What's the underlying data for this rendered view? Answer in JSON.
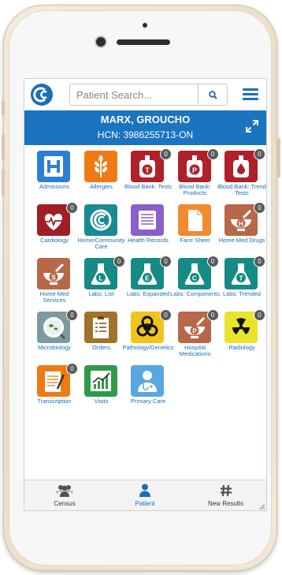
{
  "colors": {
    "brand": "#1a74c0",
    "label": "#1a6db8",
    "badge": "#5a5a5a",
    "tab_inactive": "#4f5357"
  },
  "search": {
    "placeholder": "Patient Search..."
  },
  "patient": {
    "name": "MARX, GROUCHO",
    "hcn": "HCN: 3986255713-ON"
  },
  "tiles": [
    {
      "label": "Admissions",
      "icon": "hospital-h-icon",
      "color": "#2d7fd6",
      "badge": ""
    },
    {
      "label": "Allergies",
      "icon": "wheat-icon",
      "color": "#f07a12",
      "badge": ""
    },
    {
      "label": "Blood Bank: Tests",
      "icon": "blood-bag-t-icon",
      "color": "#b0202a",
      "badge": "0"
    },
    {
      "label": "Blood Bank: Products",
      "icon": "blood-bag-p-icon",
      "color": "#b0202a",
      "badge": "0"
    },
    {
      "label": "Blood Bank: Trend Tests",
      "icon": "blood-drop-icon",
      "color": "#b0202a",
      "badge": "0"
    },
    {
      "label": "Cardiology",
      "icon": "heart-ecg-icon",
      "color": "#a01e26",
      "badge": "0"
    },
    {
      "label": "Home/Community Care",
      "icon": "community-care-icon",
      "color": "#1a8a92",
      "badge": ""
    },
    {
      "label": "Health Records",
      "icon": "health-records-icon",
      "color": "#8b5fc9",
      "badge": ""
    },
    {
      "label": "Face Sheet",
      "icon": "document-icon",
      "color": "#f28a2e",
      "badge": ""
    },
    {
      "label": "Home Med Drugs",
      "icon": "mortar-h-icon",
      "color": "#b86748",
      "badge": "0"
    },
    {
      "label": "Home Med Services",
      "icon": "mortar-s-icon",
      "color": "#b86748",
      "badge": ""
    },
    {
      "label": "Labs: List",
      "icon": "flask-l-icon",
      "color": "#168a84",
      "badge": "0"
    },
    {
      "label": "Labs: Expanded",
      "icon": "flask-e-icon",
      "color": "#168a84",
      "badge": "0"
    },
    {
      "label": "Labs: Components",
      "icon": "flask-c-icon",
      "color": "#168a84",
      "badge": "0"
    },
    {
      "label": "Labs: Trended",
      "icon": "flask-t-icon",
      "color": "#168a84",
      "badge": "0"
    },
    {
      "label": "Microbiology",
      "icon": "microscope-icon",
      "color": "#7d9aa0",
      "badge": "0"
    },
    {
      "label": "Orders",
      "icon": "clipboard-icon",
      "color": "#a0722a",
      "badge": ""
    },
    {
      "label": "Pathology/Genetics",
      "icon": "biohazard-icon",
      "color": "#f0c419",
      "badge": "0"
    },
    {
      "label": "Hospital Medications",
      "icon": "mortar-p-icon",
      "color": "#b86748",
      "badge": "0"
    },
    {
      "label": "Radiology",
      "icon": "radiation-icon",
      "color": "#e9e42a",
      "badge": "0"
    },
    {
      "label": "Transcription",
      "icon": "notepad-icon",
      "color": "#f07a12",
      "badge": "0"
    },
    {
      "label": "Visits",
      "icon": "chart-icon",
      "color": "#2e9a4a",
      "badge": ""
    },
    {
      "label": "Primary Care",
      "icon": "doctor-icon",
      "color": "#5aa6de",
      "badge": ""
    }
  ],
  "tabs": [
    {
      "label": "Census",
      "icon": "users-icon",
      "active": false
    },
    {
      "label": "Patient",
      "icon": "user-icon",
      "active": true
    },
    {
      "label": "New Results",
      "icon": "hash-icon",
      "active": false
    }
  ]
}
